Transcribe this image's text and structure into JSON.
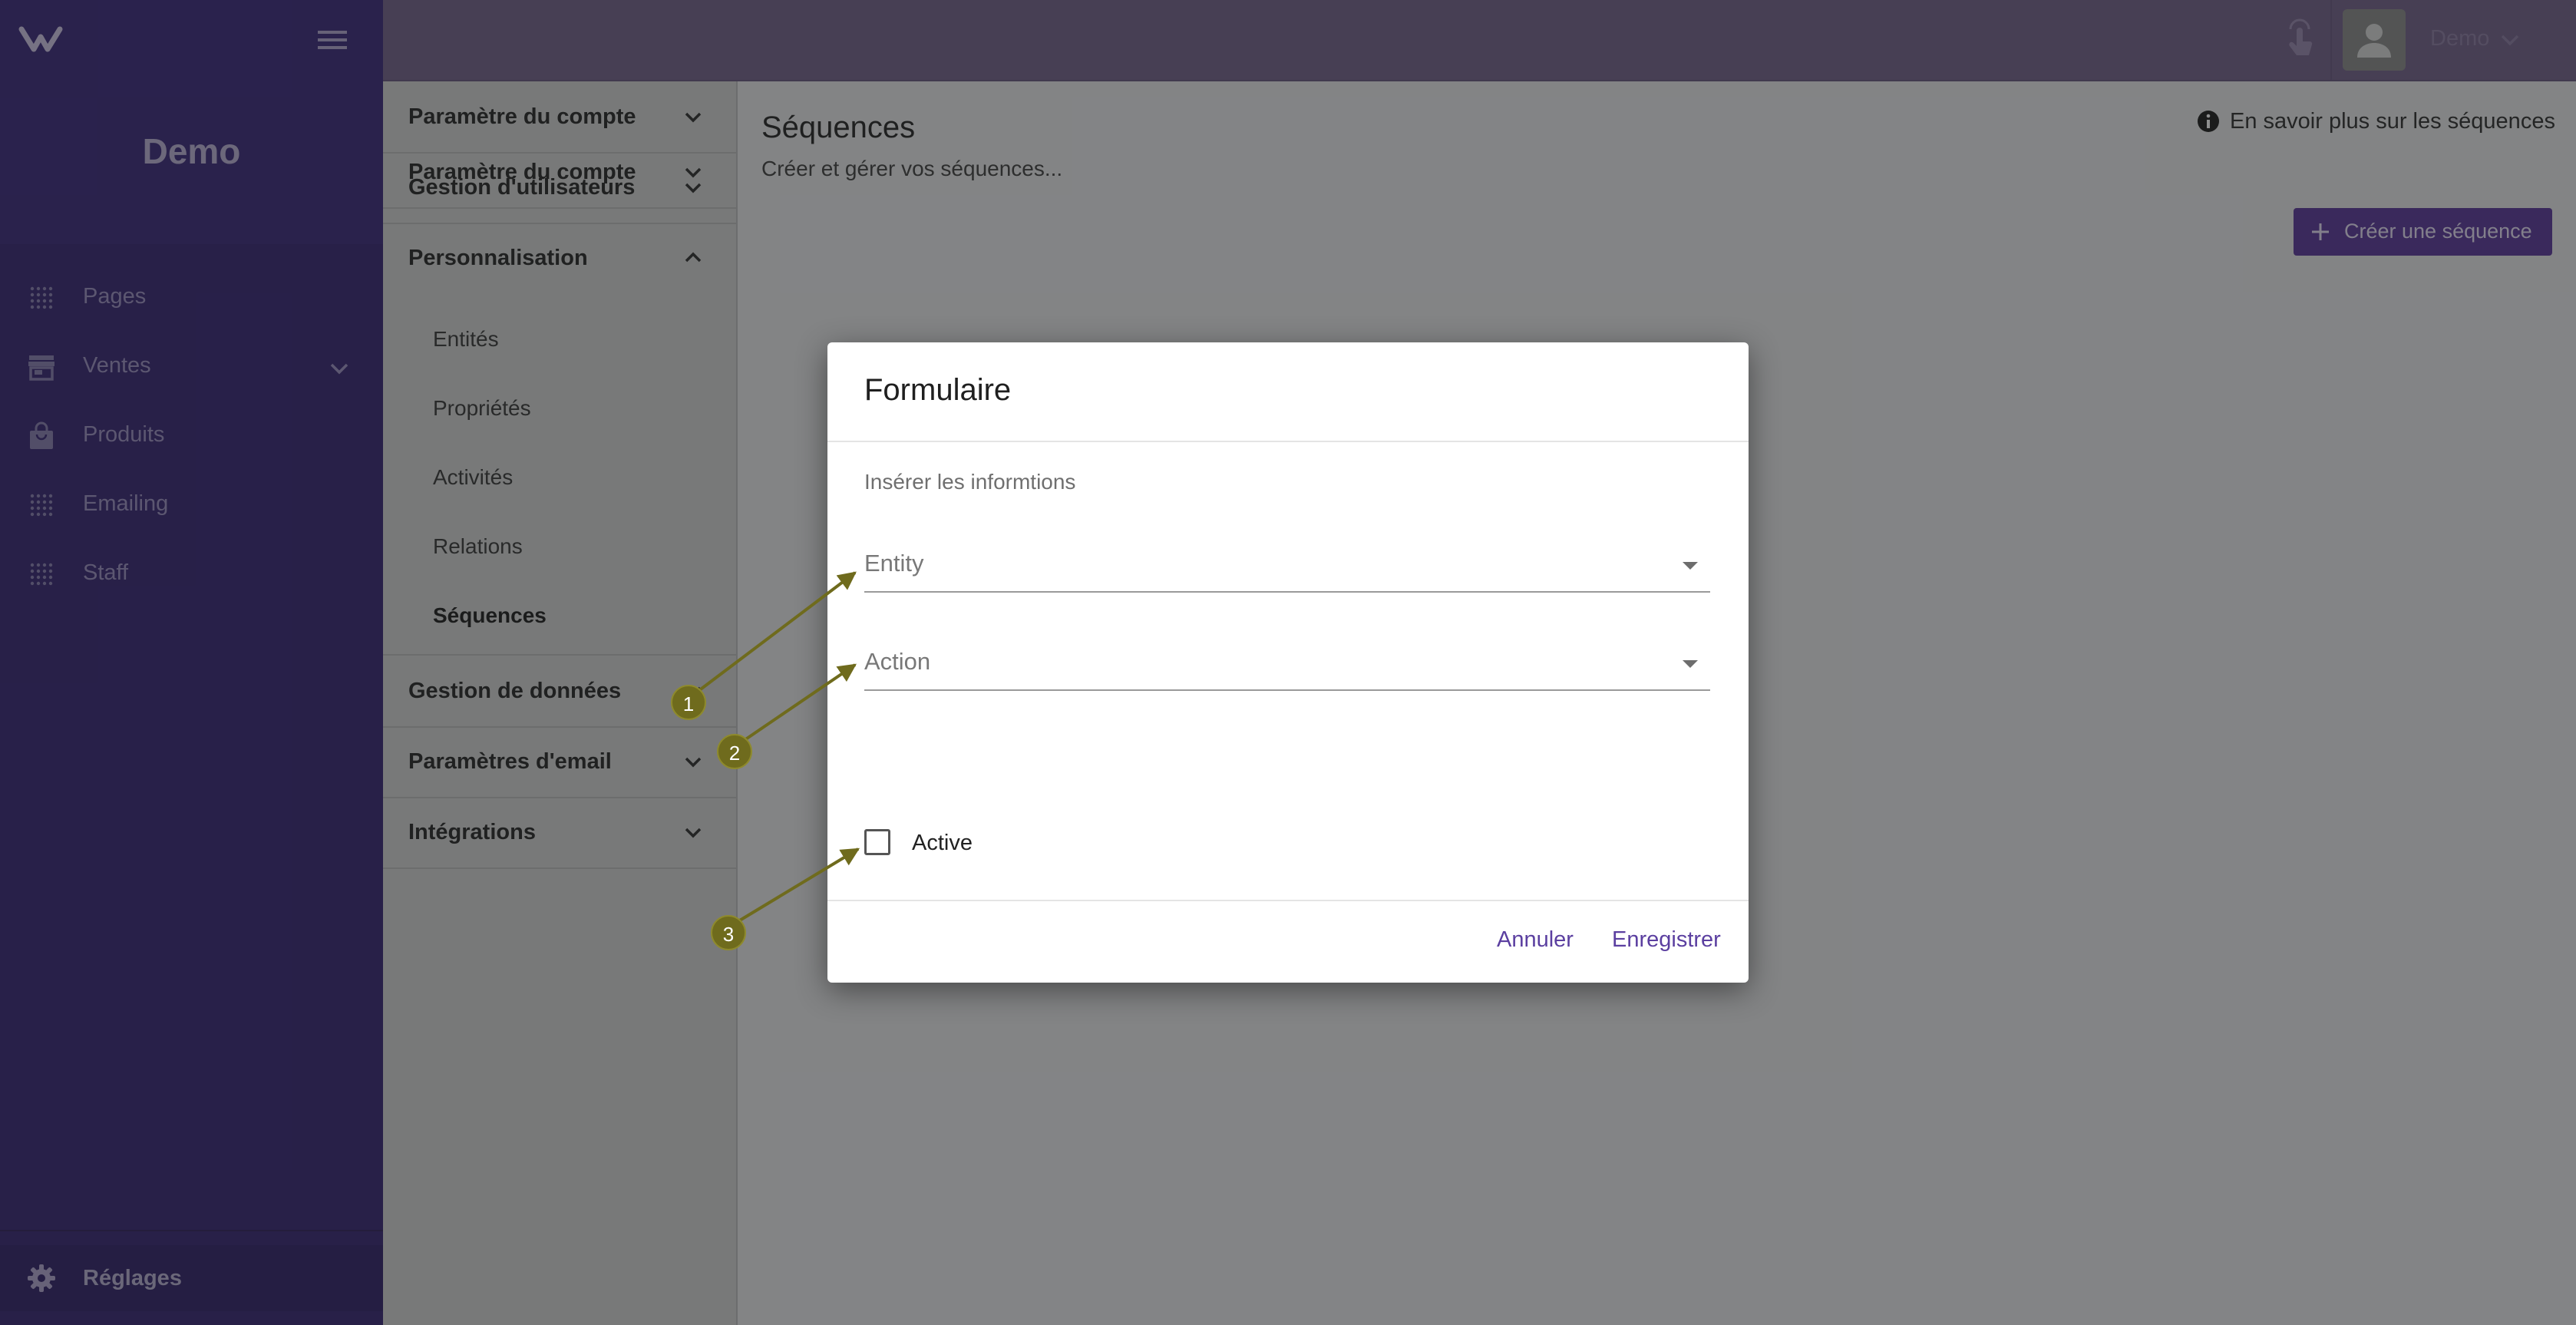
{
  "sidebar": {
    "brand": "Demo",
    "items": [
      {
        "label": "Pages",
        "icon": "grid-dots-icon"
      },
      {
        "label": "Ventes",
        "icon": "store-icon"
      },
      {
        "label": "Produits",
        "icon": "shopping-bag-icon"
      },
      {
        "label": "Emailing",
        "icon": "grid-dots-icon"
      },
      {
        "label": "Staff",
        "icon": "grid-dots-icon"
      }
    ],
    "settings_label": "Réglages"
  },
  "topbar": {
    "user": "Demo"
  },
  "settings_menu": {
    "sections": [
      {
        "label": "Paramètre du compte",
        "expanded": false
      },
      {
        "label": "Gestion d'utilisateurs",
        "expanded": false
      },
      {
        "label": "Personnalisation",
        "expanded": true
      },
      {
        "label": "Gestion de données",
        "expanded": false
      },
      {
        "label": "Paramètres d'email",
        "expanded": false
      },
      {
        "label": "Intégrations",
        "expanded": false
      }
    ],
    "sub_items": [
      "Entités",
      "Propriétés",
      "Activités",
      "Relations",
      "Séquences"
    ],
    "active_sub": "Séquences"
  },
  "main": {
    "title": "Séquences",
    "subtitle": "Créer et gérer vos séquences...",
    "info_link": "En savoir plus sur les séquences",
    "create_button": "Créer une séquence"
  },
  "dialog": {
    "title": "Formulaire",
    "hint": "Insérer les informtions",
    "entity_placeholder": "Entity",
    "action_placeholder": "Action",
    "active_label": "Active",
    "active_checked": false,
    "cancel": "Annuler",
    "save": "Enregistrer"
  },
  "annotations": [
    "1",
    "2",
    "3"
  ],
  "colors": {
    "sidebar": "#3b2a75",
    "accent": "#5c3b9c",
    "annotation": "#6f6b1d"
  }
}
